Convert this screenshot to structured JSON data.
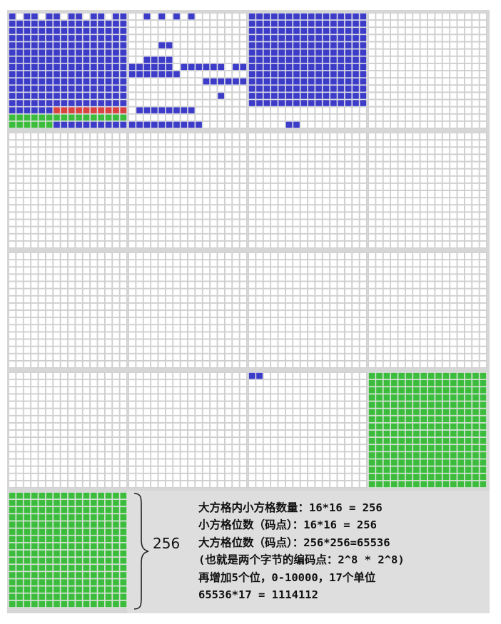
{
  "diagram": {
    "planes_grid": {
      "rows": 5,
      "cols": 4,
      "cells_per_side": 16
    },
    "colors": {
      "blue": "#3c3cc8",
      "green": "#3cbc3c",
      "red": "#d84242",
      "empty": "#ffffff",
      "cell_border": "#c8c8c8",
      "board": "#d6d6d6"
    },
    "planes": [
      {
        "fill": "blue-dense"
      },
      {
        "fill": "blue-sparse"
      },
      {
        "fill": "blue-mostly"
      },
      {
        "fill": "empty"
      },
      {
        "fill": "empty"
      },
      {
        "fill": "empty"
      },
      {
        "fill": "empty"
      },
      {
        "fill": "empty"
      },
      {
        "fill": "empty"
      },
      {
        "fill": "empty"
      },
      {
        "fill": "empty"
      },
      {
        "fill": "empty"
      },
      {
        "fill": "empty"
      },
      {
        "fill": "empty"
      },
      {
        "fill": "blue-speck"
      },
      {
        "fill": "green"
      },
      {
        "fill": "green"
      }
    ],
    "brace_label": "256",
    "notes": [
      "大方格内小方格数量：16*16 = 256",
      "小方格位数（码点）：16*16 = 256",
      "大方格位数（码点）：256*256=65536",
      "(也就是两个字节的编码点：2^8 * 2^8)",
      "再增加5个位，0-10000，17个单位",
      "65536*17 = 1114112"
    ]
  }
}
